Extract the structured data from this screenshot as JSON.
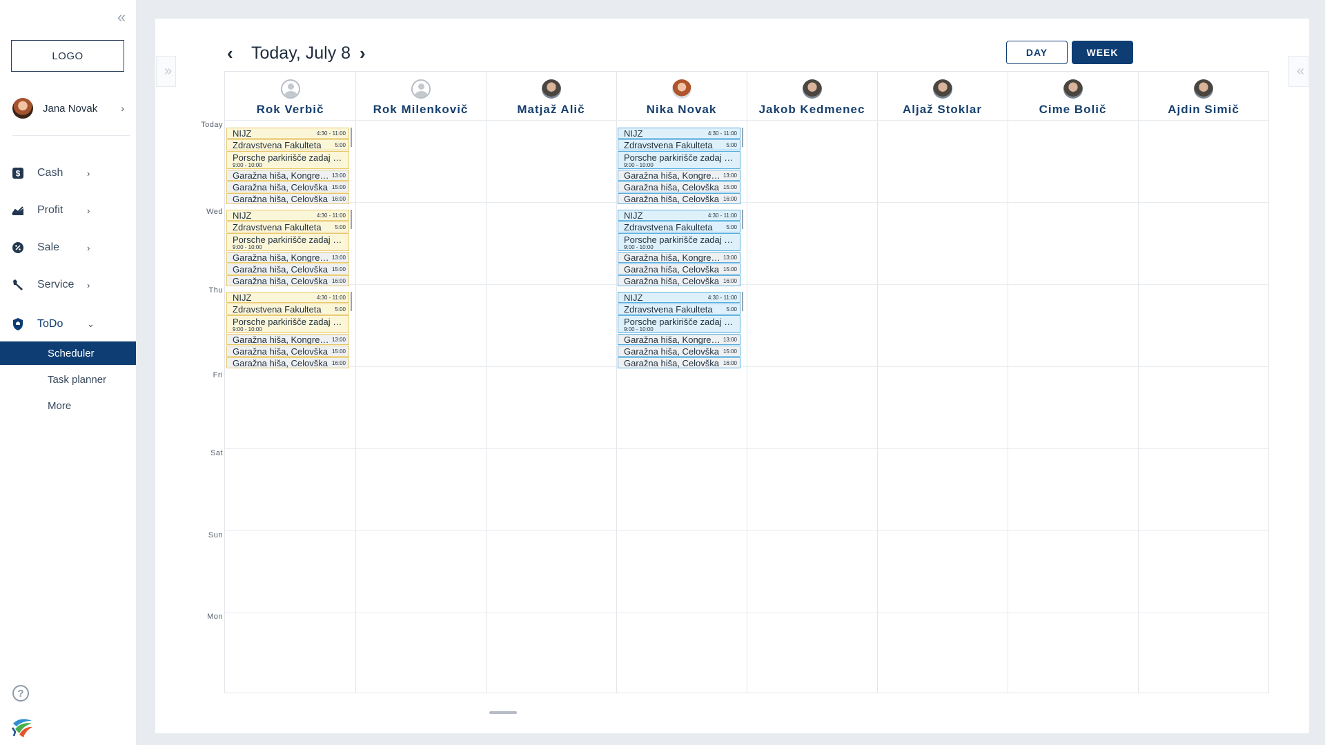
{
  "sidebar": {
    "logo": "LOGO",
    "user": {
      "name": "Jana Novak"
    },
    "nav": [
      {
        "label": "Cash",
        "icon": "dollar-icon"
      },
      {
        "label": "Profit",
        "icon": "chart-icon"
      },
      {
        "label": "Sale",
        "icon": "badge-icon"
      },
      {
        "label": "Service",
        "icon": "wrench-icon"
      },
      {
        "label": "ToDo",
        "icon": "shield-icon"
      }
    ],
    "sub_items": [
      {
        "label": "Scheduler"
      },
      {
        "label": "Task planner"
      },
      {
        "label": "More"
      }
    ]
  },
  "header": {
    "date_title": "Today, July 8",
    "view_day": "DAY",
    "view_week": "WEEK"
  },
  "resources": [
    {
      "name": "Rok Verbič"
    },
    {
      "name": "Rok Milenkovič"
    },
    {
      "name": "Matjaž Alič"
    },
    {
      "name": "Nika Novak"
    },
    {
      "name": "Jakob Kedmenec"
    },
    {
      "name": "Aljaž Stoklar"
    },
    {
      "name": "Cime Bolič"
    },
    {
      "name": "Ajdin Simič"
    }
  ],
  "days": [
    "Today",
    "Wed",
    "Thu",
    "Fri",
    "Sat",
    "Sun",
    "Mon"
  ],
  "events": [
    {
      "title": "NIJZ",
      "time": "4:30 - 11:00"
    },
    {
      "title": "Zdravstvena Fakulteta",
      "time": "5:00"
    },
    {
      "title": "Porsche parkirišče zadaj pri...",
      "time": "9:00 - 10:00"
    },
    {
      "title": "Garažna hiša, Kongresni...",
      "time": "13:00"
    },
    {
      "title": "Garažna hiša, Celovška",
      "time": "15:00"
    },
    {
      "title": "Garažna hiša, Celovška",
      "time": "16:00"
    }
  ],
  "colors": {
    "primary": "#0e3d73",
    "event_yellow_bg": "#fcf6d8",
    "event_yellow_border": "#e8c86a",
    "event_blue_bg": "#def1fb",
    "event_blue_border": "#5aaee0"
  }
}
